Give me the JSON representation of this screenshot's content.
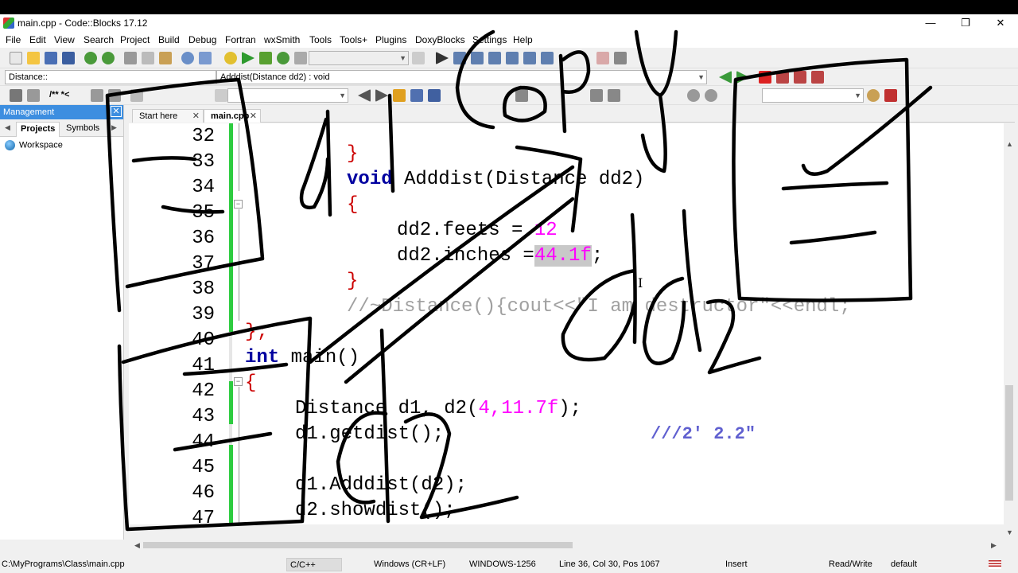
{
  "window": {
    "title": "main.cpp - Code::Blocks 17.12"
  },
  "menu": [
    "File",
    "Edit",
    "View",
    "Search",
    "Project",
    "Build",
    "Debug",
    "Fortran",
    "wxSmith",
    "Tools",
    "Tools+",
    "Plugins",
    "DoxyBlocks",
    "Settings",
    "Help"
  ],
  "toolbar": {
    "scope_combo": "Distance::",
    "function_combo": "Adddist(Distance dd2) : void",
    "doxy_label": "/** *<"
  },
  "management": {
    "title": "Management",
    "tabs": [
      "Projects",
      "Symbols"
    ],
    "tree_root": "Workspace"
  },
  "editor": {
    "tabs": [
      "Start here",
      "main.cpp"
    ],
    "line_numbers": [
      "32",
      "33",
      "34",
      "35",
      "36",
      "37",
      "38",
      "39",
      "40",
      "41",
      "42",
      "43",
      "44",
      "45",
      "46",
      "47"
    ],
    "lines": {
      "l32": "}",
      "l33_kw": "void",
      "l33_rest": " Adddist(Distance dd2)",
      "l34": "{",
      "l35_a": "dd2.feets = ",
      "l35_num": "12",
      "l36_a": "dd2.inches =",
      "l36_num": "44.1f",
      "l36_b": ";",
      "l37": "}",
      "l38": "//~Distance(){cout<<\"I am destructor\"<<endl;",
      "l39": "};",
      "l40_kw": "int",
      "l40_rest": " main()",
      "l41": "{",
      "l42_a": "Distance d1, d2(",
      "l42_nums": "4,11.7f",
      "l42_b": ");",
      "l43": "d1.getdist();",
      "l45": "d1.Adddist(d2);",
      "l46": "d2.showdist();"
    },
    "comment_note": "///2' 2.2\""
  },
  "status": {
    "path": "C:\\MyPrograms\\Class\\main.cpp",
    "lang": "C/C++",
    "eol": "Windows (CR+LF)",
    "encoding": "WINDOWS-1256",
    "position": "Line 36, Col 30, Pos 1067",
    "mode": "Insert",
    "access": "Read/Write",
    "profile": "default"
  },
  "colors": {
    "keyword": "#0000a0",
    "brace": "#cc0000",
    "number": "#ff00ff",
    "comment": "#a0a0a0",
    "changebar": "#2ecc40",
    "panel_header": "#3d8ee0"
  }
}
